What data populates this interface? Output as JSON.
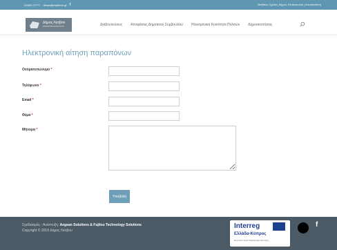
{
  "topbar": {
    "phone": "22530 27777",
    "email": "dimos@mytilene.gr",
    "fb_label": "f",
    "right_text": "Βοήθεια: Σχόλια_δήμου, Επικοινωνία | Αποσύνδεση"
  },
  "header": {
    "logo_title": "Δήμος Λέσβου",
    "logo_subtitle": "ΔΗΜΟΤΙΚΗ ΕΝΟΤΗΤΑ",
    "nav": [
      "Διαβουλεύσεις",
      "Αποφάσεις Δημοτικού Συμβουλίου",
      "Ηλεκτρονική Κοινότητα Πολιτών",
      "Δημοσκοπήσεις"
    ]
  },
  "form": {
    "title": "Ηλεκτρονική αίτηση παραπόνων",
    "fields": [
      {
        "label": "Ονοματεπώνυμο",
        "required": "*"
      },
      {
        "label": "Τηλέφωνο",
        "required": "*"
      },
      {
        "label": "Email",
        "required": "*"
      },
      {
        "label": "Θέμα",
        "required": "*"
      },
      {
        "label": "Μήνυμα",
        "required": "*"
      }
    ],
    "submit_label": "Υποβολή"
  },
  "footer": {
    "line1_prefix": "Σχεδιασμός - Ανάπτυξη:",
    "line1_bold": "Aegean Solutions & Fujitsu Technology Solutions",
    "line2": "Copyright © 2019 Δήμος Λέσβου",
    "interreg_title": "Interreg",
    "interreg_subtitle": "Ελλάδα-Κύπρος",
    "interreg_tiny": "Ευρωπαϊκό Ταμείο Περιφερειακής Ανάπτυξης",
    "fb_icon": "f"
  },
  "colors": {
    "topbar": "#5f97b3",
    "accent": "#6f9fb8",
    "footer": "#4c5a66"
  }
}
